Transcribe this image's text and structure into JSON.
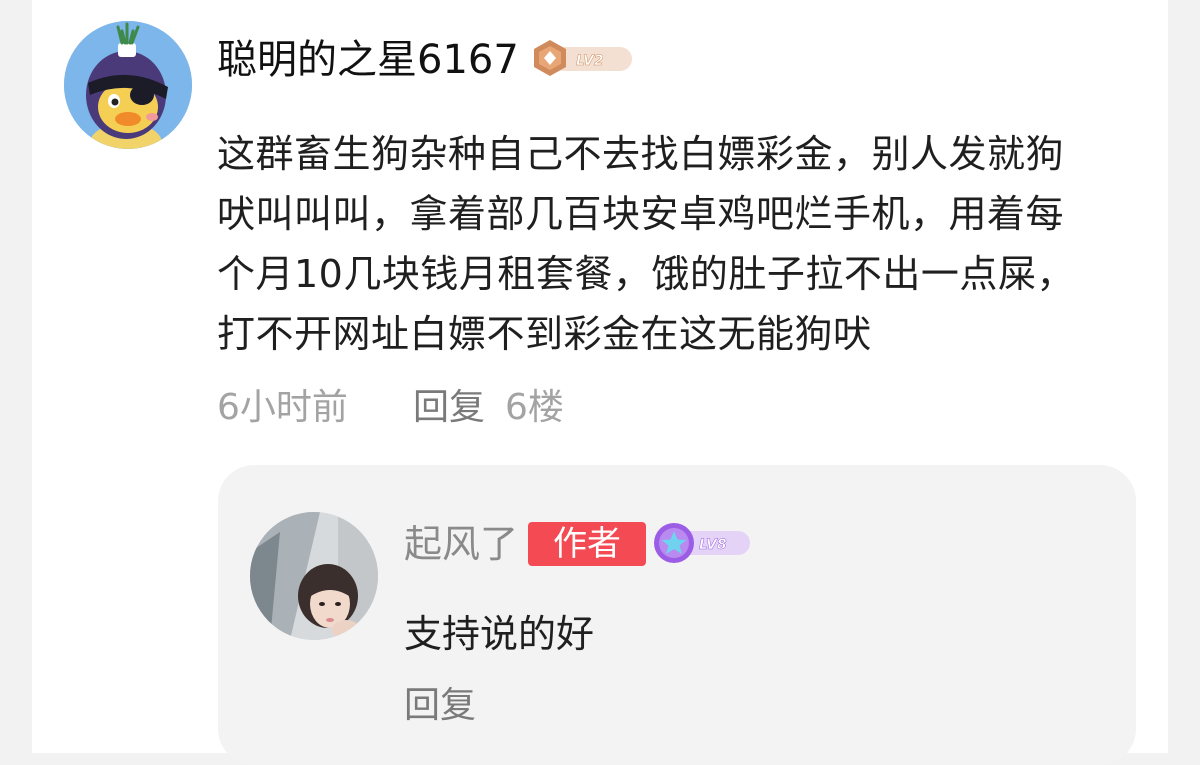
{
  "comment": {
    "username": "聪明的之星6167",
    "level_badge": "LV2",
    "text": "这群畜生狗杂种自己不去找白嫖彩金，别人发就狗吠叫叫叫，拿着部几百块安卓鸡吧烂手机，用着每个月10几块钱月租套餐，饿的肚子拉不出一点屎，打不开网址白嫖不到彩金在这无能狗吠",
    "time": "6小时前",
    "reply_label": "回复",
    "floor": "6楼"
  },
  "reply": {
    "username": "起风了",
    "author_tag": "作者",
    "level_badge": "LV8",
    "text": "支持说的好",
    "reply_label": "回复"
  },
  "colors": {
    "author_tag_bg": "#f44a54",
    "lv2_badge": "#d08a5c",
    "lv8_badge": "#9b5de5",
    "avatar_bg": "#7cb6ea"
  },
  "icons": {
    "lv2_badge": "bronze-medal-icon",
    "lv8_badge": "purple-star-medal-icon"
  }
}
